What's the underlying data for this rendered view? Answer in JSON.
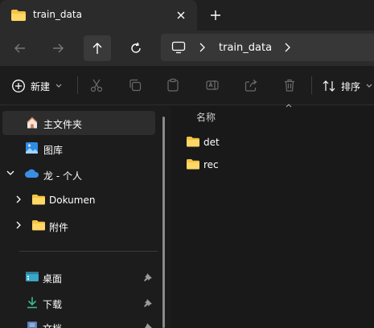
{
  "tab": {
    "title": "train_data"
  },
  "address": {
    "crumbs": [
      "train_data"
    ]
  },
  "toolbar": {
    "new_label": "新建",
    "sort_label": "排序"
  },
  "nav": {
    "home": "主文件夹",
    "pictures": "图库",
    "onedrive": "龙 - 个人",
    "documents": "Dokumen",
    "attachments": "附件",
    "desktop": "桌面",
    "downloads": "下载",
    "documents_quick": "文档"
  },
  "content": {
    "column_name": "名称",
    "items": [
      {
        "name": "det",
        "type": "folder"
      },
      {
        "name": "rec",
        "type": "folder"
      }
    ]
  },
  "colors": {
    "folder": "#f6c343",
    "accent": "#4cc2ff",
    "selected_bg": "#2d2d2d"
  }
}
